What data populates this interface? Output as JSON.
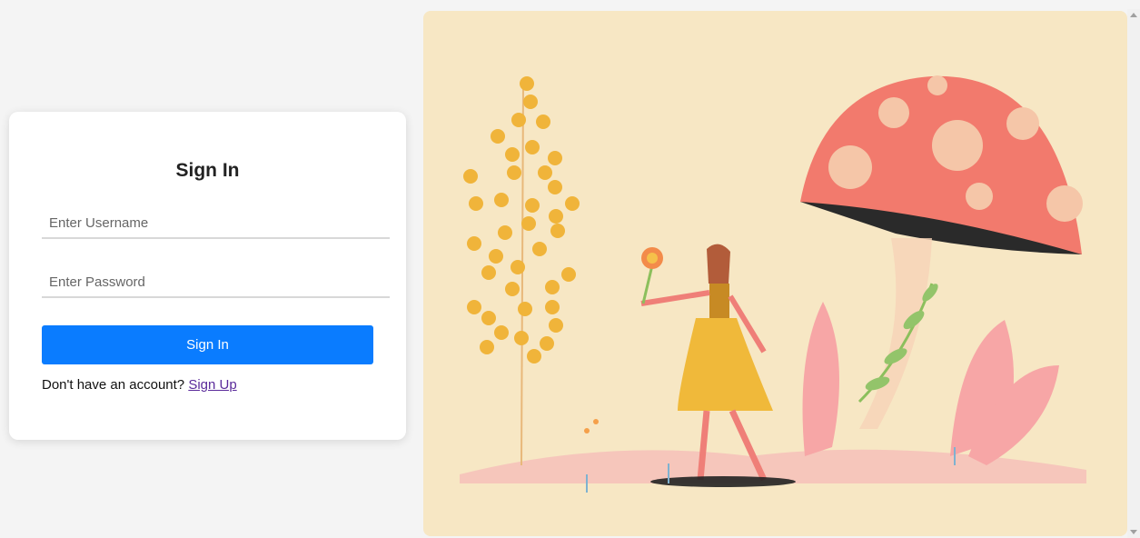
{
  "signin": {
    "title": "Sign In",
    "username_placeholder": "Enter Username",
    "password_placeholder": "Enter Password",
    "button_label": "Sign In",
    "footer_text": "Don't have an account?",
    "signup_link": "Sign Up"
  },
  "colors": {
    "primary": "#0a7cff",
    "art_background": "#f7e7c4"
  }
}
